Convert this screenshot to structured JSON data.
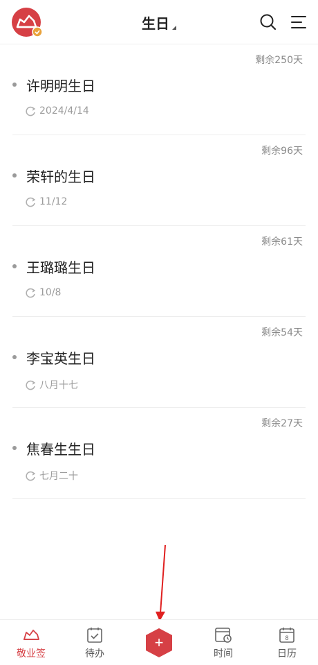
{
  "header": {
    "title": "生日",
    "logo_icon": "app-logo-icon",
    "search_icon": "search-icon",
    "menu_icon": "menu-icon"
  },
  "birthdays": [
    {
      "name": "许明明生日",
      "remaining": "剩余250天",
      "date": "2024/4/14"
    },
    {
      "name": "荣轩的生日",
      "remaining": "剩余96天",
      "date": "11/12"
    },
    {
      "name": "王璐璐生日",
      "remaining": "剩余61天",
      "date": "10/8"
    },
    {
      "name": "李宝英生日",
      "remaining": "剩余54天",
      "date": "八月十七"
    },
    {
      "name": "焦春生生日",
      "remaining": "剩余27天",
      "date": "七月二十"
    }
  ],
  "bottom_nav": {
    "items": [
      {
        "label": "敬业签",
        "icon": "app-logo-icon",
        "active": true
      },
      {
        "label": "待办",
        "icon": "todo-icon"
      },
      {
        "label": "时间",
        "icon": "time-icon"
      },
      {
        "label": "日历",
        "icon": "calendar-icon",
        "badge": "8"
      }
    ],
    "add_label": "+"
  },
  "colors": {
    "accent": "#d64045",
    "text": "#222222",
    "muted": "#9c9c9c"
  }
}
